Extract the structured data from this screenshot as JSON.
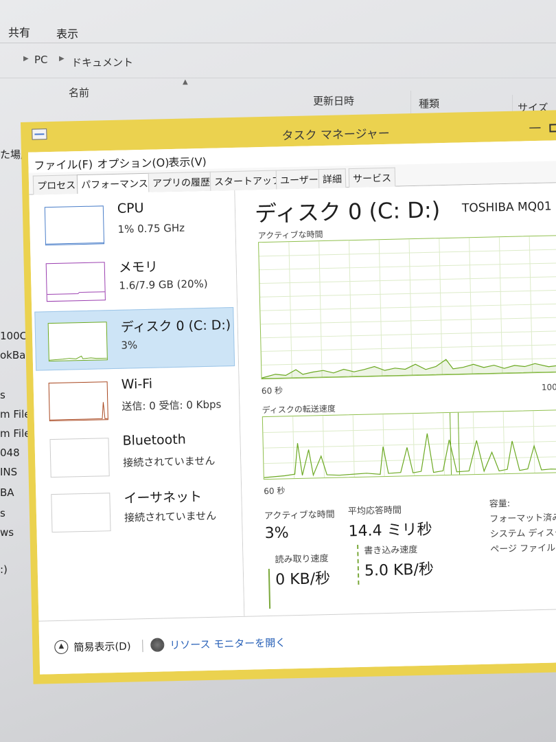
{
  "explorer": {
    "ribbon_tabs": [
      "共有",
      "表示"
    ],
    "breadcrumb": [
      "PC",
      "ドキュメント"
    ],
    "columns": {
      "name": "名前",
      "modified": "更新日時",
      "type": "種類",
      "size": "サイズ"
    },
    "sidebar_fragments": [
      "た場所",
      "100C",
      "okBa",
      "s",
      "m File",
      "m File",
      "048",
      "INS",
      "BA",
      "s",
      "ws",
      ":)"
    ]
  },
  "taskmanager": {
    "title": "タスク マネージャー",
    "menu": [
      "ファイル(F)",
      "オプション(O)",
      "表示(V)"
    ],
    "tabs": [
      "プロセス",
      "パフォーマンス",
      "アプリの履歴",
      "スタートアップ",
      "ユーザー",
      "詳細",
      "サービス"
    ],
    "active_tab": "パフォーマンス",
    "resources": [
      {
        "title": "CPU",
        "subtitle": "1% 0.75 GHz",
        "color": "#4a7ec9",
        "selected": false
      },
      {
        "title": "メモリ",
        "subtitle": "1.6/7.9 GB (20%)",
        "color": "#9b3fb0",
        "selected": false
      },
      {
        "title": "ディスク 0 (C: D:)",
        "subtitle": "3%",
        "color": "#6aa820",
        "selected": true
      },
      {
        "title": "Wi-Fi",
        "subtitle": "送信: 0 受信: 0 Kbps",
        "color": "#a8461e",
        "selected": false
      },
      {
        "title": "Bluetooth",
        "subtitle": "接続されていません",
        "color": "#cccccc",
        "selected": false
      },
      {
        "title": "イーサネット",
        "subtitle": "接続されていません",
        "color": "#cccccc",
        "selected": false
      }
    ],
    "detail": {
      "title": "ディスク 0 (C: D:)",
      "model": "TOSHIBA MQ01",
      "graph1_label": "アクティブな時間",
      "graph1_time": "60 秒",
      "graph1_max": "100",
      "graph2_label": "ディスクの転送速度",
      "graph2_time": "60 秒",
      "active_time_label": "アクティブな時間",
      "active_time_value": "3%",
      "avg_response_label": "平均応答時間",
      "avg_response_value": "14.4 ミリ秒",
      "read_label": "読み取り速度",
      "read_value": "0 KB/秒",
      "write_label": "書き込み速度",
      "write_value": "5.0 KB/秒",
      "capacity_label": "容量:",
      "formatted_label": "フォーマット済み:",
      "system_disk_label": "システム ディスク:",
      "page_file_label": "ページ ファイル:"
    },
    "footer": {
      "fewer_details": "簡易表示(D)",
      "resource_monitor": "リソース モニターを開く"
    },
    "accent_color": "#ebd24f",
    "graph_color": "#6aa820"
  }
}
